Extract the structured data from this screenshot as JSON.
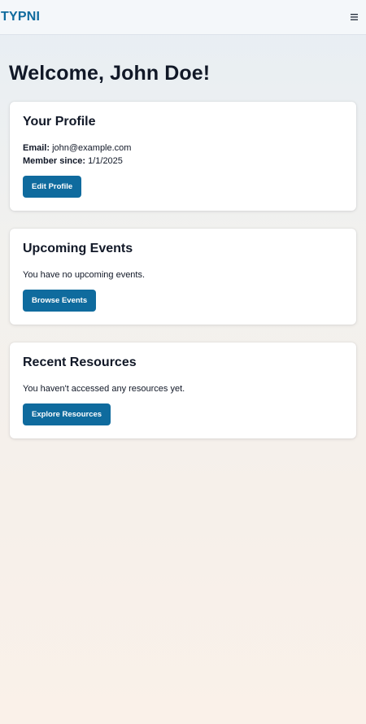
{
  "header": {
    "logo": "TYPNI",
    "menu_icon": "hamburger-menu-icon"
  },
  "main": {
    "welcome": "Welcome, John Doe!",
    "profile": {
      "title": "Your Profile",
      "email_label": "Email:",
      "email_value": "john@example.com",
      "member_label": "Member since:",
      "member_value": "1/1/2025",
      "button": "Edit Profile"
    },
    "events": {
      "title": "Upcoming Events",
      "text": "You have no upcoming events.",
      "button": "Browse Events"
    },
    "resources": {
      "title": "Recent Resources",
      "text": "You haven't accessed any resources yet.",
      "button": "Explore Resources"
    }
  },
  "colors": {
    "brand": "#0f6b9e",
    "background_top": "#e7eef4",
    "background_bottom": "#faf1e9"
  }
}
